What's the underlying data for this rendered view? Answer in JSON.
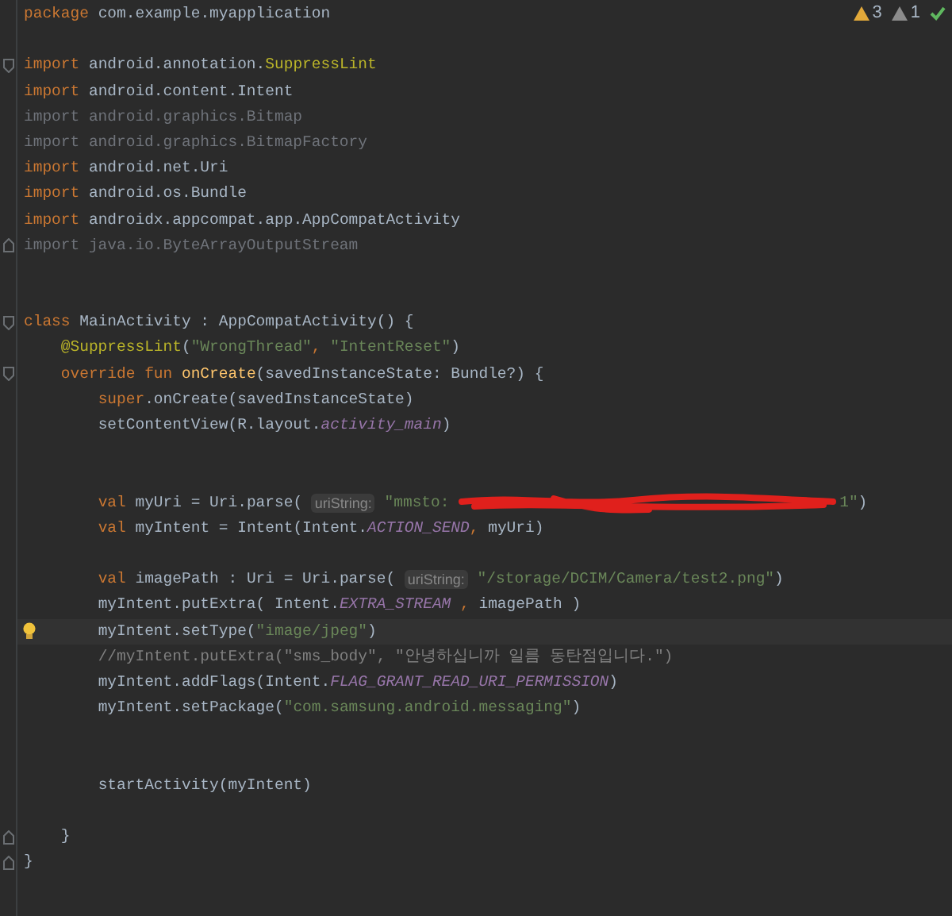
{
  "inspections": [
    {
      "kind": "warning",
      "count": "3"
    },
    {
      "kind": "weak",
      "count": "1"
    },
    {
      "kind": "ok"
    }
  ],
  "lines": [
    {
      "kind": "code",
      "tokens": [
        {
          "kind": "keyword",
          "text": "package"
        },
        {
          "kind": "plain",
          "text": " com.example.myapplication"
        }
      ]
    },
    {
      "kind": "blank"
    },
    {
      "kind": "code",
      "gutter": {
        "kind": "fold-open"
      },
      "tokens": [
        {
          "kind": "keyword",
          "text": "import"
        },
        {
          "kind": "plain",
          "text": " android.annotation."
        },
        {
          "kind": "annotation",
          "text": "SuppressLint"
        }
      ]
    },
    {
      "kind": "code",
      "tokens": [
        {
          "kind": "keyword",
          "text": "import"
        },
        {
          "kind": "plain",
          "text": " android.content.Intent"
        }
      ]
    },
    {
      "kind": "code",
      "tokens": [
        {
          "kind": "dim",
          "text": "import android.graphics.Bitmap"
        }
      ]
    },
    {
      "kind": "code",
      "tokens": [
        {
          "kind": "dim",
          "text": "import android.graphics.BitmapFactory"
        }
      ]
    },
    {
      "kind": "code",
      "tokens": [
        {
          "kind": "keyword",
          "text": "import"
        },
        {
          "kind": "plain",
          "text": " android.net.Uri"
        }
      ]
    },
    {
      "kind": "code",
      "tokens": [
        {
          "kind": "keyword",
          "text": "import"
        },
        {
          "kind": "plain",
          "text": " android.os.Bundle"
        }
      ]
    },
    {
      "kind": "code",
      "tokens": [
        {
          "kind": "keyword",
          "text": "import"
        },
        {
          "kind": "plain",
          "text": " androidx.appcompat.app.AppCompatActivity"
        }
      ]
    },
    {
      "kind": "code",
      "gutter": {
        "kind": "fold-close"
      },
      "tokens": [
        {
          "kind": "dim",
          "text": "import java.io.ByteArrayOutputStream"
        }
      ]
    },
    {
      "kind": "blank"
    },
    {
      "kind": "blank"
    },
    {
      "kind": "code",
      "gutter": {
        "kind": "fold-open"
      },
      "tokens": [
        {
          "kind": "keyword",
          "text": "class"
        },
        {
          "kind": "plain",
          "text": " MainActivity : AppCompatActivity() {"
        }
      ]
    },
    {
      "kind": "code",
      "tokens": [
        {
          "kind": "annotation",
          "text": "    @SuppressLint"
        },
        {
          "kind": "plain",
          "text": "("
        },
        {
          "kind": "string",
          "text": "\"WrongThread\""
        },
        {
          "kind": "keyword",
          "text": ", "
        },
        {
          "kind": "string",
          "text": "\"IntentReset\""
        },
        {
          "kind": "plain",
          "text": ")"
        }
      ]
    },
    {
      "kind": "code",
      "gutter": {
        "kind": "fold-open"
      },
      "tokens": [
        {
          "kind": "keyword",
          "text": "    override fun"
        },
        {
          "kind": "function",
          "text": " onCreate"
        },
        {
          "kind": "plain",
          "text": "(savedInstanceState: Bundle?) {"
        }
      ]
    },
    {
      "kind": "code",
      "tokens": [
        {
          "kind": "keyword",
          "text": "        super"
        },
        {
          "kind": "plain",
          "text": ".onCreate(savedInstanceState)"
        }
      ]
    },
    {
      "kind": "code",
      "tokens": [
        {
          "kind": "plain",
          "text": "        setContentView(R.layout."
        },
        {
          "kind": "constant",
          "text": "activity_main"
        },
        {
          "kind": "plain",
          "text": ")"
        }
      ]
    },
    {
      "kind": "blank"
    },
    {
      "kind": "blank"
    },
    {
      "kind": "code",
      "tokens": [
        {
          "kind": "keyword",
          "text": "        val"
        },
        {
          "kind": "plain",
          "text": " myUri = Uri.parse( "
        },
        {
          "kind": "hint",
          "text": "uriString:"
        },
        {
          "kind": "string",
          "text": " \"mmsto: "
        },
        {
          "kind": "redaction"
        },
        {
          "kind": "string",
          "text": "1\""
        },
        {
          "kind": "plain",
          "text": ")"
        }
      ]
    },
    {
      "kind": "code",
      "tokens": [
        {
          "kind": "keyword",
          "text": "        val"
        },
        {
          "kind": "plain",
          "text": " myIntent = Intent(Intent."
        },
        {
          "kind": "constant",
          "text": "ACTION_SEND"
        },
        {
          "kind": "keyword",
          "text": ","
        },
        {
          "kind": "plain",
          "text": " myUri)"
        }
      ]
    },
    {
      "kind": "blank"
    },
    {
      "kind": "code",
      "tokens": [
        {
          "kind": "keyword",
          "text": "        val"
        },
        {
          "kind": "plain",
          "text": " imagePath : Uri = Uri.parse( "
        },
        {
          "kind": "hint",
          "text": "uriString:"
        },
        {
          "kind": "string",
          "text": " \"/storage/DCIM/Camera/test2.png\""
        },
        {
          "kind": "plain",
          "text": ")"
        }
      ]
    },
    {
      "kind": "code",
      "tokens": [
        {
          "kind": "plain",
          "text": "        myIntent.putExtra( Intent."
        },
        {
          "kind": "constant",
          "text": "EXTRA_STREAM"
        },
        {
          "kind": "keyword",
          "text": " ,"
        },
        {
          "kind": "plain",
          "text": " imagePath )"
        }
      ]
    },
    {
      "kind": "code",
      "gutter": {
        "kind": "bulb"
      },
      "current": true,
      "tokens": [
        {
          "kind": "plain",
          "text": "        myIntent.setType("
        },
        {
          "kind": "string",
          "text": "\"image/jpeg\""
        },
        {
          "kind": "plain",
          "text": ")"
        }
      ]
    },
    {
      "kind": "code",
      "tokens": [
        {
          "kind": "comment",
          "text": "        //myIntent.putExtra(\"sms_body\", \"안녕하십니까 일름 동탄점입니다.\")"
        }
      ]
    },
    {
      "kind": "code",
      "tokens": [
        {
          "kind": "plain",
          "text": "        myIntent.addFlags(Intent."
        },
        {
          "kind": "constant",
          "text": "FLAG_GRANT_READ_URI_PERMISSION"
        },
        {
          "kind": "plain",
          "text": ")"
        }
      ]
    },
    {
      "kind": "code",
      "tokens": [
        {
          "kind": "plain",
          "text": "        myIntent.setPackage("
        },
        {
          "kind": "string",
          "text": "\"com.samsung.android.messaging\""
        },
        {
          "kind": "plain",
          "text": ")"
        }
      ]
    },
    {
      "kind": "blank"
    },
    {
      "kind": "blank"
    },
    {
      "kind": "code",
      "tokens": [
        {
          "kind": "plain",
          "text": "        startActivity(myIntent)"
        }
      ]
    },
    {
      "kind": "blank"
    },
    {
      "kind": "code",
      "gutter": {
        "kind": "fold-close"
      },
      "tokens": [
        {
          "kind": "plain",
          "text": "    }"
        }
      ]
    },
    {
      "kind": "code",
      "gutter": {
        "kind": "fold-close"
      },
      "tokens": [
        {
          "kind": "plain",
          "text": "}"
        }
      ]
    }
  ]
}
